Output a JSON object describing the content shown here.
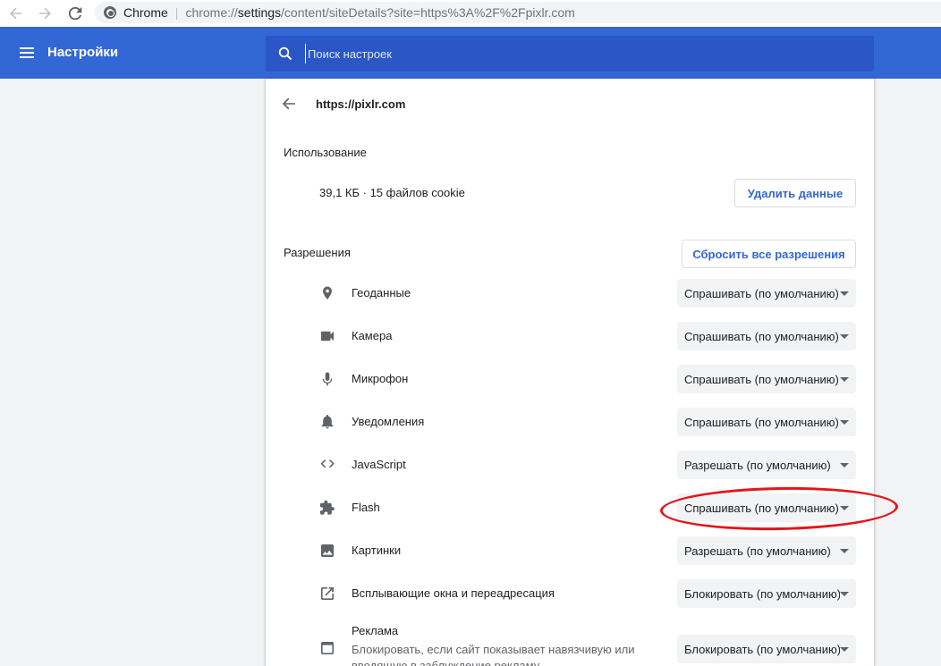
{
  "browser": {
    "origin_label": "Chrome",
    "url_scheme": "chrome://",
    "url_host": "settings",
    "url_rest": "/content/siteDetails?site=https%3A%2F%2Fpixlr.com"
  },
  "header": {
    "title": "Настройки",
    "search_placeholder": "Поиск настроек"
  },
  "site": {
    "title": "https://pixlr.com"
  },
  "usage": {
    "label": "Использование",
    "text": "39,1 КБ · 15 файлов cookie",
    "delete_button": "Удалить данные"
  },
  "permissions": {
    "label": "Разрешения",
    "reset_button": "Сбросить все разрешения",
    "items": [
      {
        "icon": "location-icon",
        "label": "Геоданные",
        "value": "Спрашивать (по умолчанию)"
      },
      {
        "icon": "camera-icon",
        "label": "Камера",
        "value": "Спрашивать (по умолчанию)"
      },
      {
        "icon": "microphone-icon",
        "label": "Микрофон",
        "value": "Спрашивать (по умолчанию)"
      },
      {
        "icon": "bell-icon",
        "label": "Уведомления",
        "value": "Спрашивать (по умолчанию)"
      },
      {
        "icon": "code-icon",
        "label": "JavaScript",
        "value": "Разрешать (по умолчанию)"
      },
      {
        "icon": "puzzle-icon",
        "label": "Flash",
        "value": "Спрашивать (по умолчанию)"
      },
      {
        "icon": "image-icon",
        "label": "Картинки",
        "value": "Разрешать (по умолчанию)"
      },
      {
        "icon": "open-in-new-icon",
        "label": "Всплывающие окна и переадресация",
        "value": "Блокировать (по умолчанию)"
      }
    ],
    "ads": {
      "icon": "ads-window-icon",
      "label": "Реклама",
      "description": "Блокировать, если сайт показывает навязчивую или вводящую в заблуждение рекламу",
      "value": "Блокировать (по умолчанию)"
    }
  },
  "colors": {
    "header_blue": "#3367d6",
    "search_blue": "#2a56c6",
    "annotation_red": "#e3161b"
  }
}
